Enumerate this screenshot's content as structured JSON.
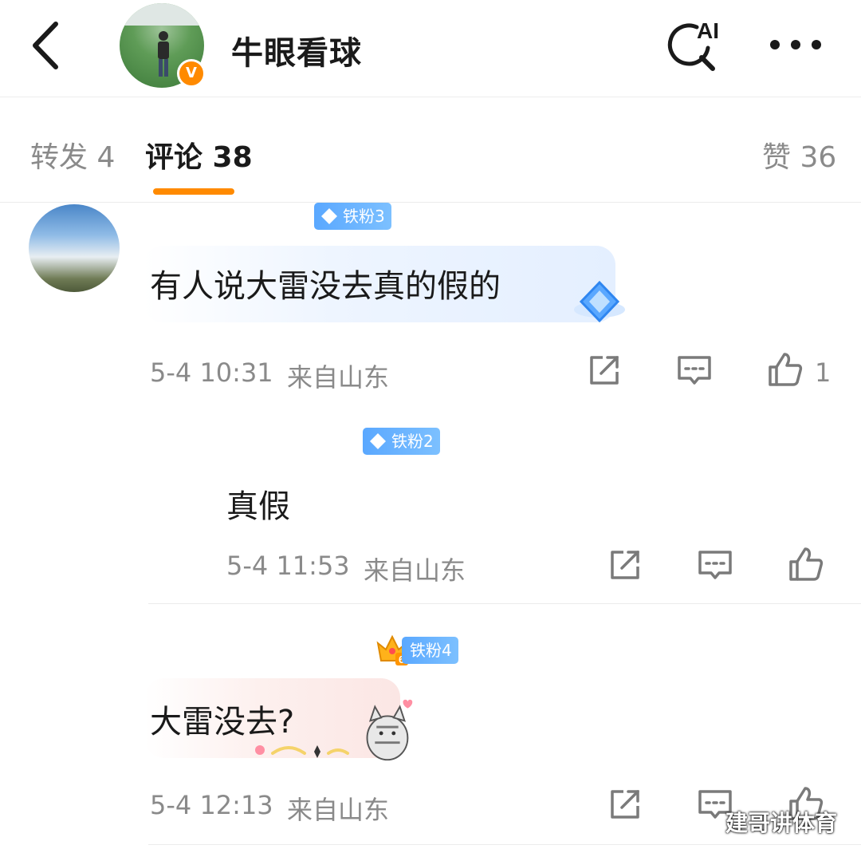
{
  "header": {
    "title": "牛眼看球",
    "verified_mark": "V",
    "ai_label": "AI"
  },
  "tabs": [
    {
      "label": "转发 4"
    },
    {
      "label": "评论 38"
    },
    {
      "label": "赞 36"
    }
  ],
  "comments": [
    {
      "badge": "铁粉3",
      "text": "有人说大雷没去真的假的",
      "time": "5-4 10:31",
      "location": "来自山东",
      "like_count": "1"
    },
    {
      "badge": "铁粉2",
      "text": "真假",
      "time": "5-4 11:53",
      "location": "来自山东",
      "like_count": ""
    },
    {
      "badge": "铁粉4",
      "crown_number": "6",
      "text": "大雷没去?",
      "time": "5-4 12:13",
      "location": "来自山东",
      "like_count": ""
    }
  ],
  "watermark": "建哥讲体育",
  "colors": {
    "accent": "#ff8a00",
    "badge_blue": "#5aa8ff",
    "muted_text": "#8a8a8a"
  }
}
